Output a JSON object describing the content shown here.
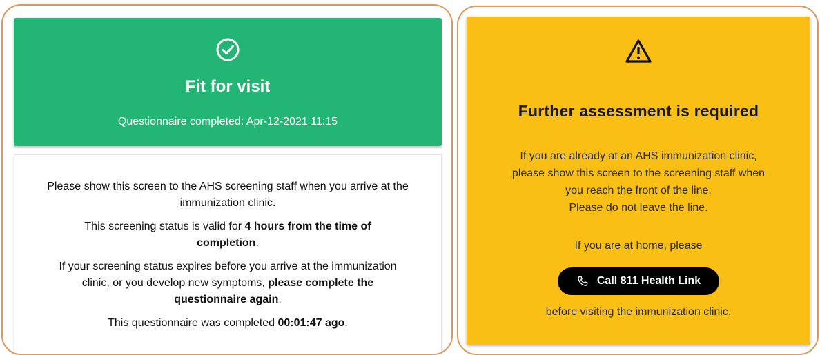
{
  "left_panel": {
    "status": {
      "icon": "check-circle-icon",
      "title": "Fit for visit",
      "completed_text": "Questionnaire completed: Apr-12-2021 11:15",
      "color": "#22b573"
    },
    "info": {
      "p1": "Please show this screen to the AHS screening staff when you arrive at the immunization clinic.",
      "p2_pre": "This screening status is valid for ",
      "p2_bold": "4 hours from the time of completion",
      "p2_post": ".",
      "p3_pre": "If your screening status expires before you arrive at the immunization clinic, or you develop new symptoms, ",
      "p3_bold": "please complete the questionnaire again",
      "p3_post": ".",
      "p4_pre": "This questionnaire was completed ",
      "p4_bold": "00:01:47 ago",
      "p4_post": "."
    }
  },
  "right_panel": {
    "icon": "warning-triangle-icon",
    "title": "Further assessment is required",
    "paragraph_lines": [
      "If you are already at an AHS immunization clinic,",
      "please show this screen to the screening staff when",
      "you reach the front of the line.",
      "Please do not leave the line."
    ],
    "home_text": "If you are at home, please",
    "call_button_label": "Call 811 Health Link",
    "call_button_icon": "phone-icon",
    "before_text": "before visiting the immunization clinic.",
    "color": "#f9bf14"
  }
}
